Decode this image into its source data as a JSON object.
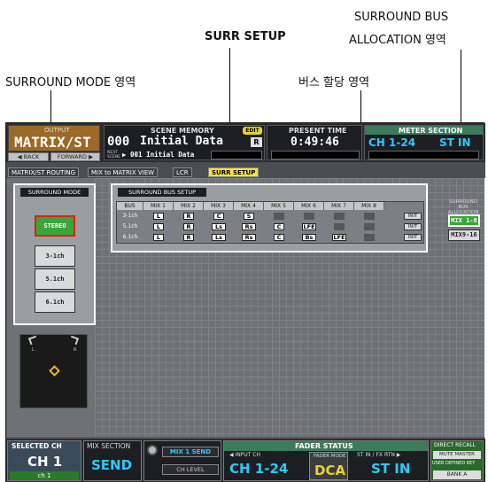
{
  "callouts": {
    "surround_bus_allocation_line1": "SURROUND BUS",
    "surround_bus_allocation_line2": "ALLOCATION 영역",
    "surr_setup": "SURR SETUP",
    "surround_mode": "SURROUND MODE 영역",
    "bus_assign": "버스 할당 영역"
  },
  "topbar": {
    "output_label": "OUTPUT",
    "output_value": "MATRIX/ST",
    "back": "◀ BACK",
    "forward": "FORWARD ▶",
    "scene_memory_label": "SCENE MEMORY",
    "edit_badge": "EDIT",
    "scene_number": "000",
    "scene_name": "Initial Data",
    "r_badge": "R",
    "next_scene_label": "NEXT SCENE",
    "next_scene_value": "▶ 001 Initial Data",
    "present_time_label": "PRESENT TIME",
    "present_time_value": "0:49:46",
    "meter_section_label": "METER SECTION",
    "meter_ch": "CH 1-24",
    "meter_st": "ST IN"
  },
  "tabs": [
    "MATRIX/ST ROUTING",
    "MIX to MATRIX VIEW",
    "LCR",
    "SURR SETUP"
  ],
  "surround_mode": {
    "title": "SURROUND MODE",
    "options": [
      "STEREO",
      "3-1ch",
      "5.1ch",
      "6.1ch"
    ],
    "selected": "STEREO",
    "pan_l": "L",
    "pan_r": "R"
  },
  "bus_setup": {
    "title": "SURROUND BUS SETUP",
    "headers": [
      "BUS",
      "MIX 1",
      "MIX 2",
      "MIX 3",
      "MIX 4",
      "MIX 5",
      "MIX 6",
      "MIX 7",
      "MIX 8"
    ],
    "rows": [
      {
        "name": "3-1ch",
        "cells": [
          "L",
          "R",
          "C",
          "S",
          "",
          "",
          "",
          ""
        ],
        "init": "INIT"
      },
      {
        "name": "5.1ch",
        "cells": [
          "L",
          "R",
          "Ls",
          "Rs",
          "C",
          "LFE",
          "",
          ""
        ],
        "init": "INIT"
      },
      {
        "name": "6.1ch",
        "cells": [
          "L",
          "R",
          "Ls",
          "Rs",
          "C",
          "Bs",
          "LFE",
          ""
        ],
        "init": "INIT"
      }
    ]
  },
  "allocation": {
    "title_line1": "SURROUND BUS",
    "title_line2": "ALLOCATION",
    "options": [
      "MIX 1-8",
      "MIX9-16"
    ],
    "selected": "MIX 1-8"
  },
  "bottombar": {
    "selected_ch_label": "SELECTED CH",
    "selected_ch_value": "CH 1",
    "selected_ch_sub": "ch 1",
    "mix_section_label": "MIX SECTION",
    "mix_section_value": "SEND",
    "mix_send": "MIX 1 SEND",
    "ch_level": "CH LEVEL",
    "fader_status_label": "FADER STATUS",
    "input_ch_label": "◀ INPUT CH",
    "input_ch_value": "CH 1-24",
    "fader_mode_label": "FADER MODE",
    "fader_mode_value": "DCA",
    "stin_label": "ST IN / FX RTN ▶",
    "stin_value": "ST IN",
    "direct_recall": "DIRECT RECALL",
    "mute_master": "MUTE MASTER",
    "user_defined_key": "USER DEFINED KEY",
    "bank": "BANK A"
  }
}
